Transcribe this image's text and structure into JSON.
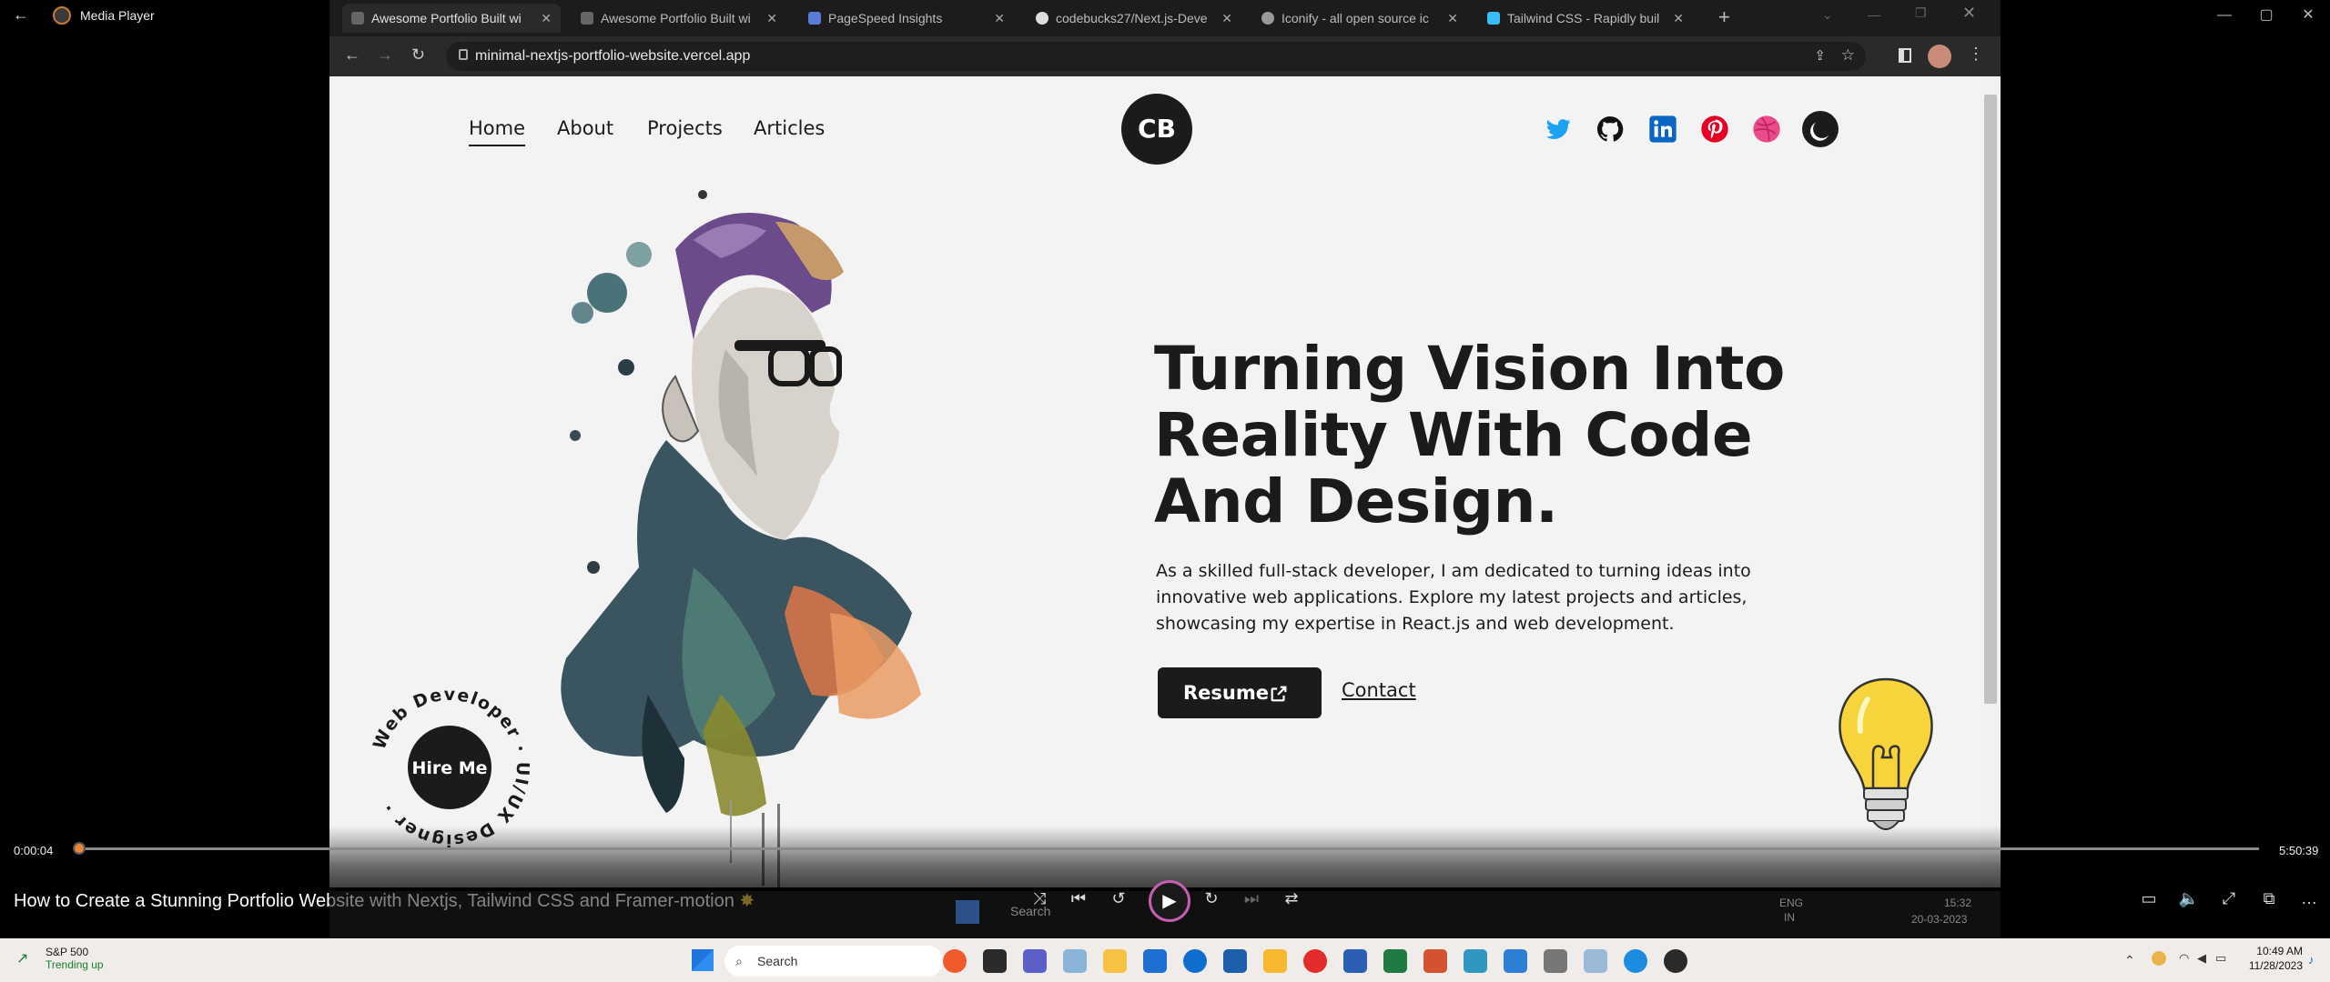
{
  "media_player": {
    "title": "Media Player",
    "video_title": "How to Create a Stunning Portfolio Website with Nextjs, Tailwind CSS and Framer-motion",
    "time_current": "0:00:04",
    "time_total": "5:50:39",
    "progress_fraction": 0.0002
  },
  "browser": {
    "tabs": [
      {
        "label": "Awesome Portfolio Built wi",
        "active": true
      },
      {
        "label": "Awesome Portfolio Built wi",
        "active": false
      },
      {
        "label": "PageSpeed Insights",
        "active": false
      },
      {
        "label": "codebucks27/Next.js-Deve",
        "active": false
      },
      {
        "label": "Iconify - all open source ic",
        "active": false
      },
      {
        "label": "Tailwind CSS - Rapidly buil",
        "active": false
      }
    ],
    "url": "minimal-nextjs-portfolio-website.vercel.app"
  },
  "site": {
    "nav": [
      "Home",
      "About",
      "Projects",
      "Articles"
    ],
    "logo": "CB",
    "socials": [
      "twitter-icon",
      "github-icon",
      "linkedin-icon",
      "pinterest-icon",
      "dribbble-icon",
      "moon-icon"
    ],
    "hero_title": "Turning Vision Into Reality With Code And Design.",
    "hero_desc": "As a skilled full-stack developer, I am dedicated to turning ideas into innovative web applications. Explore my latest projects and articles, showcasing my expertise in React.js and web development.",
    "resume_label": "Resume",
    "contact_label": "Contact",
    "hire_label": "Hire Me",
    "badge_ring_text": "Web Developer · UI/UX Designer ·"
  },
  "inner_taskbar": {
    "search": "Search",
    "lang": "ENG",
    "region": "IN",
    "time": "15:32",
    "date": "20-03-2023"
  },
  "taskbar": {
    "weather_title": "S&P 500",
    "weather_sub": "Trending up",
    "search": "Search",
    "time": "10:49 AM",
    "date": "11/28/2023"
  },
  "colors": {
    "accent_orange": "#e8863a",
    "play_ring": "#c65fb2",
    "twitter": "#1da1f2",
    "linkedin": "#0a66c2",
    "pinterest": "#e60023",
    "dribbble": "#ea4c89"
  }
}
